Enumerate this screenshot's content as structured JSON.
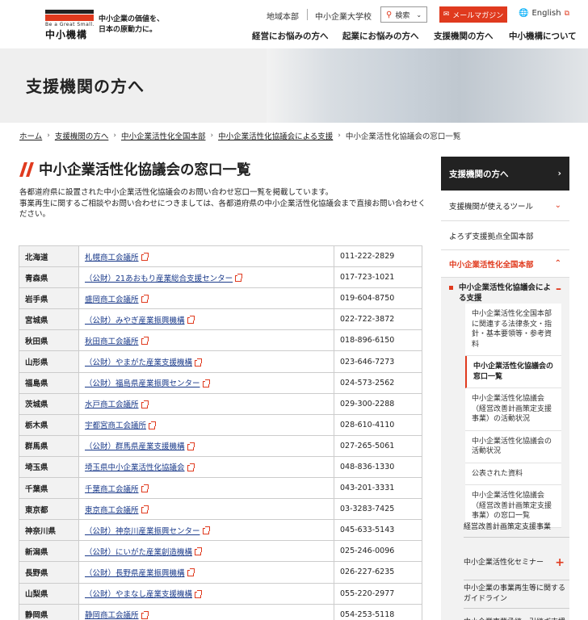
{
  "header": {
    "logo": {
      "tagline_en": "Be a Great Small.",
      "name": "中小機構",
      "slogan_line1": "中小企業の価値を、",
      "slogan_line2": "日本の原動力に。"
    },
    "util": {
      "region": "地域本部",
      "university": "中小企業大学校",
      "search": "検索",
      "mail": "メールマガジン",
      "lang": "English"
    },
    "nav": [
      "経営にお悩みの方へ",
      "起業にお悩みの方へ",
      "支援機関の方へ",
      "中小機構について"
    ]
  },
  "hero": {
    "title": "支援機関の方へ"
  },
  "breadcrumb": [
    "ホーム",
    "支援機関の方へ",
    "中小企業活性化全国本部",
    "中小企業活性化協議会による支援",
    "中小企業活性化協議会の窓口一覧"
  ],
  "main": {
    "title": "中小企業活性化協議会の窓口一覧",
    "intro_line1": "各都道府県に設置された中小企業活性化協議会のお問い合わせ窓口一覧を掲載しています。",
    "intro_line2": "事業再生に関するご相談やお問い合わせにつきましては、各都道府県の中小企業活性化協議会まで直接お問い合わせください。",
    "rows": [
      {
        "pref": "北海道",
        "org": "札幌商工会議所",
        "tel": "011-222-2829"
      },
      {
        "pref": "青森県",
        "org": "（公財）21あおもり産業総合支援センター",
        "tel": "017-723-1021"
      },
      {
        "pref": "岩手県",
        "org": "盛岡商工会議所",
        "tel": "019-604-8750"
      },
      {
        "pref": "宮城県",
        "org": "（公財）みやぎ産業振興機構",
        "tel": "022-722-3872"
      },
      {
        "pref": "秋田県",
        "org": "秋田商工会議所",
        "tel": "018-896-6150"
      },
      {
        "pref": "山形県",
        "org": "（公財）やまがた産業支援機構",
        "tel": "023-646-7273"
      },
      {
        "pref": "福島県",
        "org": "（公財）福島県産業振興センター",
        "tel": "024-573-2562"
      },
      {
        "pref": "茨城県",
        "org": "水戸商工会議所",
        "tel": "029-300-2288"
      },
      {
        "pref": "栃木県",
        "org": "宇都宮商工会議所",
        "tel": "028-610-4110"
      },
      {
        "pref": "群馬県",
        "org": "（公財）群馬県産業支援機構",
        "tel": "027-265-5061"
      },
      {
        "pref": "埼玉県",
        "org": "埼玉県中小企業活性化協議会",
        "tel": "048-836-1330"
      },
      {
        "pref": "千葉県",
        "org": "千葉商工会議所",
        "tel": "043-201-3331"
      },
      {
        "pref": "東京都",
        "org": "東京商工会議所",
        "tel": "03-3283-7425"
      },
      {
        "pref": "神奈川県",
        "org": "（公財）神奈川産業振興センター",
        "tel": "045-633-5143"
      },
      {
        "pref": "新潟県",
        "org": "（公財）にいがた産業創造機構",
        "tel": "025-246-0096"
      },
      {
        "pref": "長野県",
        "org": "（公財）長野県産業振興機構",
        "tel": "026-227-6235"
      },
      {
        "pref": "山梨県",
        "org": "（公財）やまなし産業支援機構",
        "tel": "055-220-2977"
      },
      {
        "pref": "静岡県",
        "org": "静岡商工会議所",
        "tel": "054-253-5118"
      }
    ]
  },
  "sidebar": {
    "head": "支援機関の方へ",
    "items": [
      "支援機関が使えるツール",
      "よろず支援拠点全国本部",
      "中小企業活性化全国本部"
    ],
    "sub_title": "中小企業活性化協議会による支援",
    "sub_links": [
      "中小企業活性化全国本部に関連する法律条文・指針・基本要領等・参考資料",
      "中小企業活性化協議会の窓口一覧",
      "中小企業活性化協議会（経営改善計画策定支援事業）の活動状況",
      "中小企業活性化協議会の活動状況",
      "公表された資料",
      "中小企業活性化協議会（経営改善計画策定支援事業）の窓口一覧"
    ],
    "low_links": [
      "経営改善計画策定支援事業",
      "中小企業活性化セミナー",
      "中小企業の事業再生等に関するガイドライン",
      "中小企業事業承継・引継ぎ支援"
    ]
  }
}
